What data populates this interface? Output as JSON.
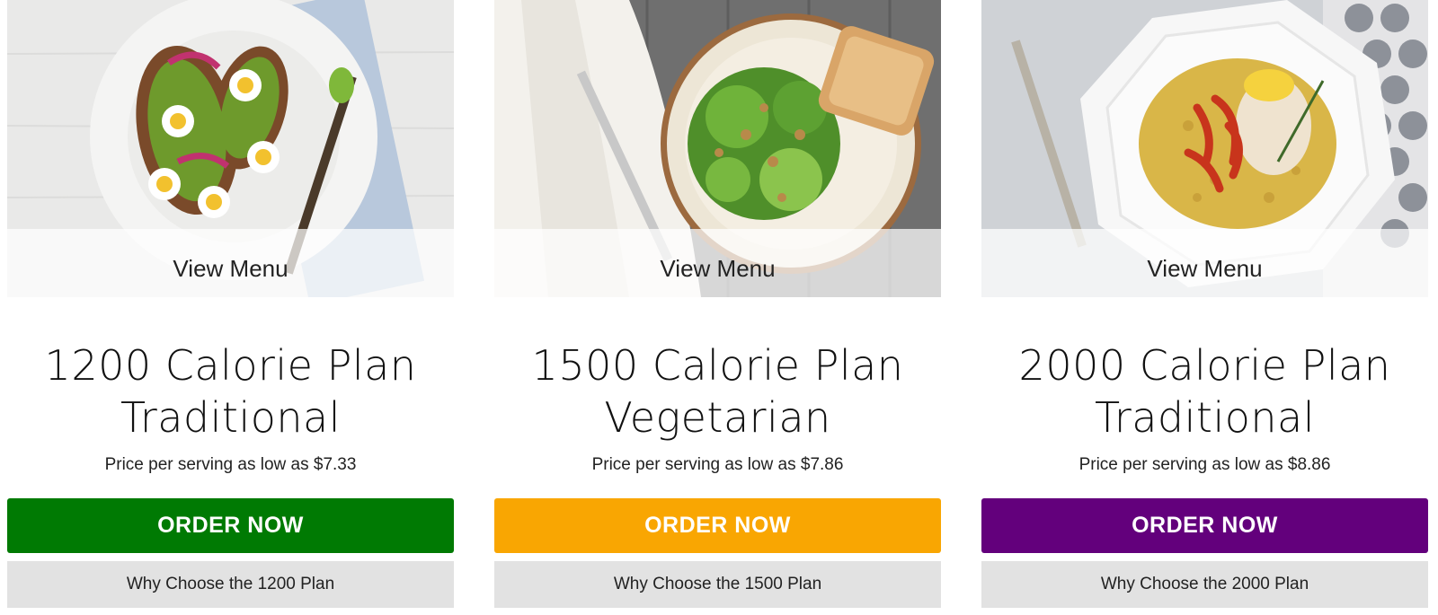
{
  "plans": [
    {
      "view_menu_label": "View Menu",
      "title_line1": "1200 Calorie Plan",
      "title_line2": "Traditional",
      "price_text": "Price per serving as low as $7.33",
      "order_label": "ORDER NOW",
      "order_color": "#007a03",
      "why_label": "Why Choose the 1200 Plan"
    },
    {
      "view_menu_label": "View Menu",
      "title_line1": "1500 Calorie Plan",
      "title_line2": "Vegetarian",
      "price_text": "Price per serving as low as $7.86",
      "order_label": "ORDER NOW",
      "order_color": "#f9a602",
      "why_label": "Why Choose the 1500 Plan"
    },
    {
      "view_menu_label": "View Menu",
      "title_line1": "2000 Calorie Plan",
      "title_line2": "Traditional",
      "price_text": "Price per serving as low as $8.86",
      "order_label": "ORDER NOW",
      "order_color": "#63007c",
      "why_label": "Why Choose the 2000 Plan"
    }
  ],
  "images": [
    {
      "name": "avocado-toast-photo"
    },
    {
      "name": "salad-photo"
    },
    {
      "name": "chicken-rice-photo"
    }
  ]
}
